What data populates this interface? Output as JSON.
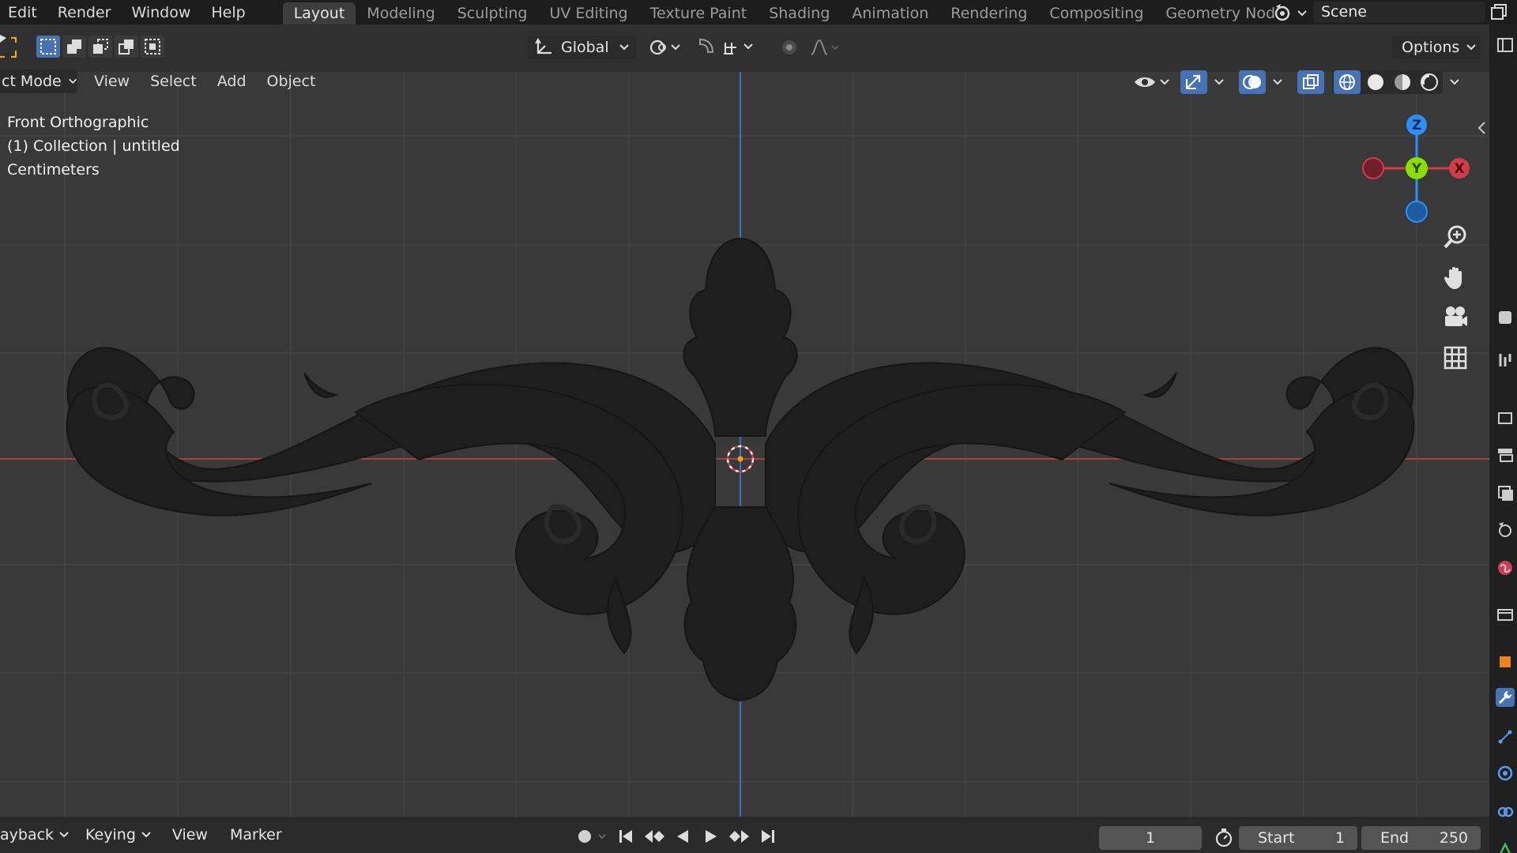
{
  "menu": [
    "Edit",
    "Render",
    "Window",
    "Help"
  ],
  "workspace_tabs": [
    {
      "label": "Layout",
      "active": true
    },
    {
      "label": "Modeling",
      "active": false
    },
    {
      "label": "Sculpting",
      "active": false
    },
    {
      "label": "UV Editing",
      "active": false
    },
    {
      "label": "Texture Paint",
      "active": false
    },
    {
      "label": "Shading",
      "active": false
    },
    {
      "label": "Animation",
      "active": false
    },
    {
      "label": "Rendering",
      "active": false
    },
    {
      "label": "Compositing",
      "active": false
    },
    {
      "label": "Geometry Nod",
      "active": false
    }
  ],
  "scene": {
    "name": "Scene",
    "icon": "scene-icon"
  },
  "header": {
    "selection_modes": [
      "select-new-icon",
      "select-extend-icon",
      "select-subtract-icon",
      "select-invert-icon",
      "select-intersect-icon"
    ],
    "transform_orientation": "Global",
    "options_label": "Options"
  },
  "viewport_menu": {
    "mode": "ct Mode",
    "items": [
      "View",
      "Select",
      "Add",
      "Object"
    ]
  },
  "viewport_info": {
    "view_name": "Front Orthographic",
    "collection": "(1) Collection | untitled",
    "units": "Centimeters"
  },
  "gizmo": {
    "z": "Z",
    "y": "Y",
    "x": "X"
  },
  "nav_tools": [
    "zoom-icon",
    "hand-pan-icon",
    "camera-icon",
    "grid-icon"
  ],
  "timeline": {
    "playback": "ayback",
    "keying": "Keying",
    "items": [
      "View",
      "Marker"
    ],
    "current_frame": "1",
    "start_label": "Start",
    "start_value": "1",
    "end_label": "End",
    "end_value": "250"
  },
  "colors": {
    "accent": "#4772b3",
    "axis_x": "#d23b4b",
    "axis_y": "#8bdc00",
    "axis_z": "#2c8fff",
    "grid_bg": "#393939"
  }
}
